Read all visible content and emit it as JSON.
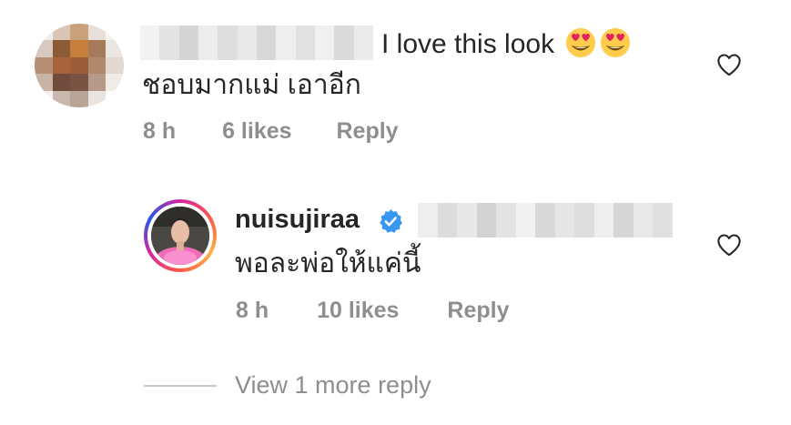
{
  "comments": [
    {
      "text_suffix": "I love this look",
      "emojis": [
        "heart-eyes-emoji",
        "heart-eyes-emoji"
      ],
      "text_line2": "ชอบมากแม่ เอาอีก",
      "time": "8 h",
      "likes": "6 likes",
      "reply_label": "Reply"
    }
  ],
  "reply": {
    "username": "nuisujiraa",
    "verified": true,
    "text": "พอละพ่อให้แค่นี้",
    "time": "8 h",
    "likes": "10 likes",
    "reply_label": "Reply"
  },
  "view_more": "View 1 more reply",
  "colors": {
    "text": "#262626",
    "meta": "#8e8e8e",
    "verified": "#3897f0"
  },
  "icons": [
    "heart-outline-icon",
    "verified-badge-icon",
    "heart-eyes-emoji"
  ]
}
